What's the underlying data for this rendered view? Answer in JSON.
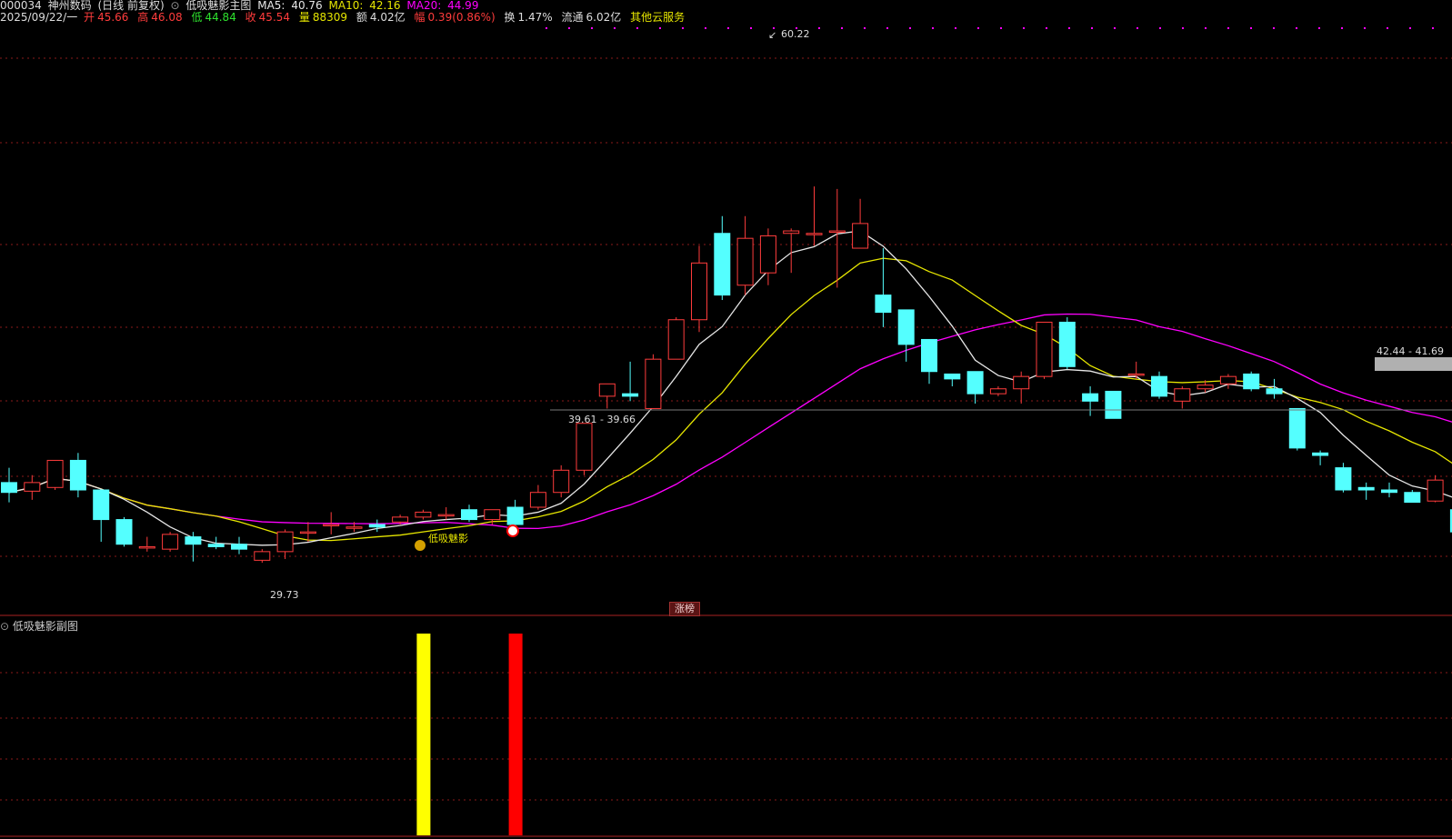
{
  "header": {
    "code": "000034",
    "name": "神州数码",
    "period": "(日线 前复权)",
    "indicator": "低吸魅影主图",
    "ma5_label": "MA5:",
    "ma5_value": "40.76",
    "ma10_label": "MA10:",
    "ma10_value": "42.16",
    "ma20_label": "MA20:",
    "ma20_value": "44.99",
    "date": "2025/09/22/一",
    "open_label": "开",
    "open": "45.66",
    "high_label": "高",
    "high": "46.08",
    "low_label": "低",
    "low": "44.84",
    "close_label": "收",
    "close": "45.54",
    "volume_label": "量",
    "volume": "88309",
    "amount_label": "额",
    "amount": "4.02亿",
    "change_label": "幅",
    "change": "0.39(0.86%)",
    "turnover_label": "换",
    "turnover": "1.47%",
    "float_label": "流通",
    "float": "6.02亿",
    "service": "其他云服务"
  },
  "annotations": {
    "high_mark": "60.22",
    "low_mark": "29.73",
    "range_mid": "39.61 - 39.66",
    "range_right": "42.44 - 41.69",
    "signal_text": "低吸魅影",
    "bottom_tag": "涨榜",
    "sub_title": "低吸魅影副图"
  },
  "colors": {
    "up": "#ff3c3c",
    "down": "#54ffff",
    "ma5": "#e6e6e6",
    "ma10": "#e6e600",
    "ma20": "#ff00ff",
    "grid": "#8a1a1a",
    "bar_yellow": "#ffff00",
    "bar_red": "#ff0000"
  },
  "chart_data": {
    "type": "candlestick",
    "price_range": [
      28,
      62
    ],
    "candles": [
      [
        36.2,
        35.4,
        37.4,
        34.6
      ],
      [
        35.5,
        36.2,
        36.8,
        34.8
      ],
      [
        35.8,
        38.0,
        38.0,
        35.6
      ],
      [
        38.0,
        35.6,
        38.6,
        35.0
      ],
      [
        35.6,
        33.2,
        35.6,
        31.4
      ],
      [
        33.2,
        31.2,
        33.4,
        31.0
      ],
      [
        31.0,
        31.0,
        31.8,
        30.6
      ],
      [
        30.8,
        32.0,
        32.2,
        30.6
      ],
      [
        31.8,
        31.2,
        32.2,
        29.8
      ],
      [
        31.2,
        31.0,
        31.8,
        30.8
      ],
      [
        31.2,
        30.8,
        31.8,
        30.4
      ],
      [
        29.9,
        30.6,
        30.8,
        29.7
      ],
      [
        30.6,
        32.2,
        32.4,
        30.0
      ],
      [
        32.2,
        32.2,
        33.0,
        31.4
      ],
      [
        32.8,
        32.8,
        33.8,
        32.0
      ],
      [
        32.6,
        32.6,
        33.0,
        32.2
      ],
      [
        32.8,
        32.6,
        33.2,
        32.2
      ],
      [
        33.0,
        33.4,
        33.6,
        32.8
      ],
      [
        33.4,
        33.8,
        34.0,
        33.2
      ],
      [
        33.6,
        33.6,
        34.2,
        33.2
      ],
      [
        34.0,
        33.2,
        34.4,
        33.0
      ],
      [
        33.2,
        34.0,
        34.0,
        32.8
      ],
      [
        34.2,
        32.8,
        34.8,
        32.6
      ],
      [
        34.2,
        35.4,
        36.0,
        34.0
      ],
      [
        35.4,
        37.2,
        37.6,
        35.0
      ],
      [
        37.2,
        41.0,
        41.0,
        36.8
      ],
      [
        43.2,
        44.2,
        44.2,
        42.2
      ],
      [
        43.4,
        43.2,
        46.0,
        42.8
      ],
      [
        42.2,
        46.2,
        46.6,
        42.2
      ],
      [
        46.2,
        49.4,
        49.6,
        46.2
      ],
      [
        49.4,
        54.0,
        55.4,
        48.4
      ],
      [
        56.4,
        51.4,
        57.8,
        51.0
      ],
      [
        52.2,
        56.0,
        57.8,
        51.4
      ],
      [
        53.2,
        56.2,
        56.8,
        52.2
      ],
      [
        56.4,
        56.6,
        56.8,
        53.2
      ],
      [
        56.4,
        56.4,
        60.2,
        55.4
      ],
      [
        56.5,
        56.6,
        60.0,
        52.0
      ],
      [
        55.2,
        57.2,
        59.2,
        55.2
      ],
      [
        51.4,
        50.0,
        55.2,
        48.8
      ],
      [
        50.2,
        47.4,
        50.2,
        46.0
      ],
      [
        47.8,
        45.2,
        47.8,
        44.2
      ],
      [
        45.0,
        44.6,
        45.0,
        44.0
      ],
      [
        45.2,
        43.4,
        45.2,
        42.6
      ],
      [
        43.4,
        43.8,
        44.0,
        43.2
      ],
      [
        43.8,
        44.8,
        45.2,
        42.6
      ],
      [
        44.8,
        49.2,
        49.2,
        44.6
      ],
      [
        49.2,
        45.6,
        49.6,
        45.4
      ],
      [
        43.4,
        42.8,
        44.0,
        41.6
      ],
      [
        43.6,
        41.4,
        43.6,
        41.4
      ],
      [
        45.0,
        45.0,
        46.0,
        44.6
      ],
      [
        44.8,
        43.2,
        45.2,
        43.0
      ],
      [
        42.8,
        43.8,
        44.0,
        42.2
      ],
      [
        43.8,
        44.1,
        44.5,
        43.5
      ],
      [
        44.2,
        44.8,
        45.0,
        43.8
      ],
      [
        45.0,
        43.8,
        45.2,
        43.6
      ],
      [
        43.8,
        43.4,
        44.6,
        43.0
      ],
      [
        42.2,
        39.0,
        42.2,
        38.8
      ],
      [
        38.6,
        38.4,
        38.8,
        37.6
      ],
      [
        37.4,
        35.6,
        37.8,
        35.4
      ],
      [
        35.8,
        35.6,
        36.2,
        34.8
      ],
      [
        35.6,
        35.4,
        36.2,
        35.0
      ],
      [
        35.4,
        34.6,
        35.6,
        34.6
      ],
      [
        34.7,
        36.4,
        36.8,
        34.6
      ],
      [
        34.0,
        32.2,
        34.2,
        31.8
      ],
      [
        32.1,
        31.4,
        32.4,
        31.3
      ]
    ],
    "ma5_last": 40.76,
    "ma10_last": 42.16,
    "ma20_last": 44.99,
    "signal_bars": [
      {
        "index": 18,
        "color": "yellow"
      },
      {
        "index": 22,
        "color": "red"
      }
    ]
  }
}
